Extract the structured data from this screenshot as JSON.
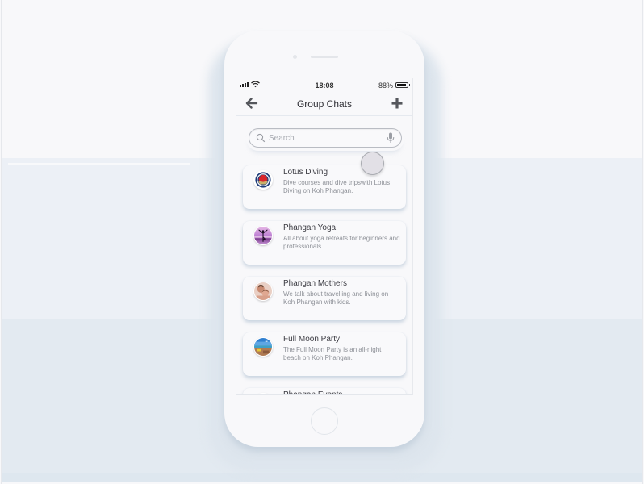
{
  "status_bar": {
    "time": "18:08",
    "battery_percent": "88%",
    "battery_level": 0.88,
    "signal_icon": "signal-bars-icon",
    "wifi_icon": "wifi-icon"
  },
  "nav": {
    "title": "Group Chats",
    "back_icon": "arrow-left-icon",
    "add_icon": "plus-icon"
  },
  "search": {
    "placeholder": "Search",
    "value": "",
    "search_icon": "search-icon",
    "mic_icon": "microphone-icon"
  },
  "groups": [
    {
      "name": "Lotus Diving",
      "description": "Dive courses and dive tripswith Lotus Diving on Koh Phangan.",
      "avatar": "lotus-diving-logo"
    },
    {
      "name": "Phangan Yoga",
      "description": "All about yoga retreats  for beginners and professionals.",
      "avatar": "yoga-silhouette-photo"
    },
    {
      "name": "Phangan Mothers",
      "description": "We talk about travelling and living on Koh Phangan with kids.",
      "avatar": "mother-child-photo"
    },
    {
      "name": "Full Moon Party",
      "description": "The Full Moon Party is an all-night beach on Koh Phangan.",
      "avatar": "beach-party-photo"
    },
    {
      "name": "Phangan Events",
      "description": "",
      "avatar": "flower-photo"
    }
  ]
}
